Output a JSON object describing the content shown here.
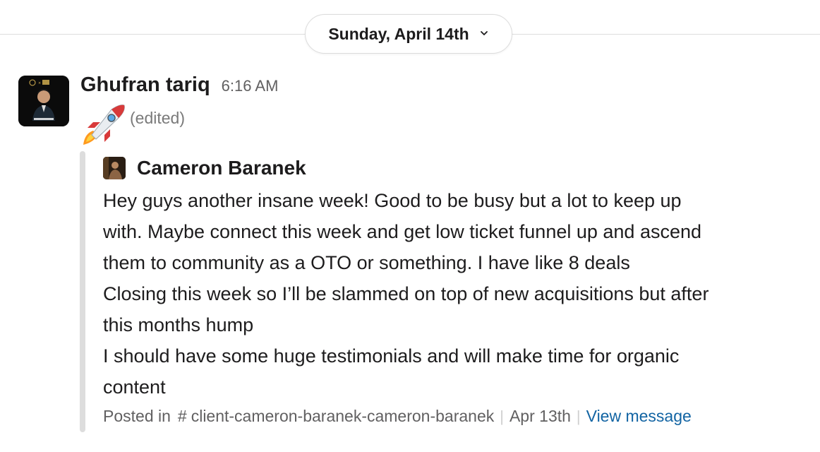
{
  "date_divider": {
    "label": "Sunday, April 14th",
    "icon": "chevron-down-icon"
  },
  "message": {
    "sender": "Ghufran tariq",
    "time": "6:16 AM",
    "reaction_emoji": "rocket-icon",
    "edited_label": "(edited)"
  },
  "shared_message": {
    "author": "Cameron Baranek",
    "lines": [
      "Hey guys another insane week! Good to be busy but a lot to keep up",
      "with. Maybe connect this week and get low ticket funnel up and ascend",
      "them to community as a OTO or something. I have like 8 deals",
      "Closing this week so I’ll be slammed on top of new acquisitions but after",
      "this months hump",
      "I should have some huge testimonials and will make time for organic",
      "content"
    ],
    "footer": {
      "posted_in_label": "Posted in",
      "hash": "#",
      "channel": "client-cameron-baranek-cameron-baranek",
      "date": "Apr 13th",
      "view_label": "View message"
    }
  },
  "colors": {
    "link": "#1264a3",
    "muted": "#616061",
    "quote_bar": "#dddddd"
  }
}
